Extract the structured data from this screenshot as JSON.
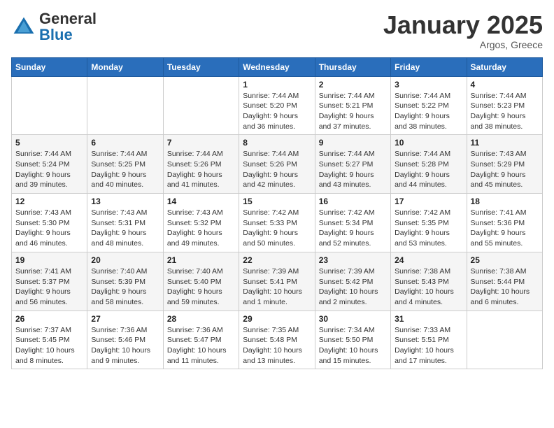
{
  "logo": {
    "general": "General",
    "blue": "Blue"
  },
  "title": "January 2025",
  "location": "Argos, Greece",
  "days_header": [
    "Sunday",
    "Monday",
    "Tuesday",
    "Wednesday",
    "Thursday",
    "Friday",
    "Saturday"
  ],
  "weeks": [
    [
      {
        "day": "",
        "info": ""
      },
      {
        "day": "",
        "info": ""
      },
      {
        "day": "",
        "info": ""
      },
      {
        "day": "1",
        "info": "Sunrise: 7:44 AM\nSunset: 5:20 PM\nDaylight: 9 hours and 36 minutes."
      },
      {
        "day": "2",
        "info": "Sunrise: 7:44 AM\nSunset: 5:21 PM\nDaylight: 9 hours and 37 minutes."
      },
      {
        "day": "3",
        "info": "Sunrise: 7:44 AM\nSunset: 5:22 PM\nDaylight: 9 hours and 38 minutes."
      },
      {
        "day": "4",
        "info": "Sunrise: 7:44 AM\nSunset: 5:23 PM\nDaylight: 9 hours and 38 minutes."
      }
    ],
    [
      {
        "day": "5",
        "info": "Sunrise: 7:44 AM\nSunset: 5:24 PM\nDaylight: 9 hours and 39 minutes."
      },
      {
        "day": "6",
        "info": "Sunrise: 7:44 AM\nSunset: 5:25 PM\nDaylight: 9 hours and 40 minutes."
      },
      {
        "day": "7",
        "info": "Sunrise: 7:44 AM\nSunset: 5:26 PM\nDaylight: 9 hours and 41 minutes."
      },
      {
        "day": "8",
        "info": "Sunrise: 7:44 AM\nSunset: 5:26 PM\nDaylight: 9 hours and 42 minutes."
      },
      {
        "day": "9",
        "info": "Sunrise: 7:44 AM\nSunset: 5:27 PM\nDaylight: 9 hours and 43 minutes."
      },
      {
        "day": "10",
        "info": "Sunrise: 7:44 AM\nSunset: 5:28 PM\nDaylight: 9 hours and 44 minutes."
      },
      {
        "day": "11",
        "info": "Sunrise: 7:43 AM\nSunset: 5:29 PM\nDaylight: 9 hours and 45 minutes."
      }
    ],
    [
      {
        "day": "12",
        "info": "Sunrise: 7:43 AM\nSunset: 5:30 PM\nDaylight: 9 hours and 46 minutes."
      },
      {
        "day": "13",
        "info": "Sunrise: 7:43 AM\nSunset: 5:31 PM\nDaylight: 9 hours and 48 minutes."
      },
      {
        "day": "14",
        "info": "Sunrise: 7:43 AM\nSunset: 5:32 PM\nDaylight: 9 hours and 49 minutes."
      },
      {
        "day": "15",
        "info": "Sunrise: 7:42 AM\nSunset: 5:33 PM\nDaylight: 9 hours and 50 minutes."
      },
      {
        "day": "16",
        "info": "Sunrise: 7:42 AM\nSunset: 5:34 PM\nDaylight: 9 hours and 52 minutes."
      },
      {
        "day": "17",
        "info": "Sunrise: 7:42 AM\nSunset: 5:35 PM\nDaylight: 9 hours and 53 minutes."
      },
      {
        "day": "18",
        "info": "Sunrise: 7:41 AM\nSunset: 5:36 PM\nDaylight: 9 hours and 55 minutes."
      }
    ],
    [
      {
        "day": "19",
        "info": "Sunrise: 7:41 AM\nSunset: 5:37 PM\nDaylight: 9 hours and 56 minutes."
      },
      {
        "day": "20",
        "info": "Sunrise: 7:40 AM\nSunset: 5:39 PM\nDaylight: 9 hours and 58 minutes."
      },
      {
        "day": "21",
        "info": "Sunrise: 7:40 AM\nSunset: 5:40 PM\nDaylight: 9 hours and 59 minutes."
      },
      {
        "day": "22",
        "info": "Sunrise: 7:39 AM\nSunset: 5:41 PM\nDaylight: 10 hours and 1 minute."
      },
      {
        "day": "23",
        "info": "Sunrise: 7:39 AM\nSunset: 5:42 PM\nDaylight: 10 hours and 2 minutes."
      },
      {
        "day": "24",
        "info": "Sunrise: 7:38 AM\nSunset: 5:43 PM\nDaylight: 10 hours and 4 minutes."
      },
      {
        "day": "25",
        "info": "Sunrise: 7:38 AM\nSunset: 5:44 PM\nDaylight: 10 hours and 6 minutes."
      }
    ],
    [
      {
        "day": "26",
        "info": "Sunrise: 7:37 AM\nSunset: 5:45 PM\nDaylight: 10 hours and 8 minutes."
      },
      {
        "day": "27",
        "info": "Sunrise: 7:36 AM\nSunset: 5:46 PM\nDaylight: 10 hours and 9 minutes."
      },
      {
        "day": "28",
        "info": "Sunrise: 7:36 AM\nSunset: 5:47 PM\nDaylight: 10 hours and 11 minutes."
      },
      {
        "day": "29",
        "info": "Sunrise: 7:35 AM\nSunset: 5:48 PM\nDaylight: 10 hours and 13 minutes."
      },
      {
        "day": "30",
        "info": "Sunrise: 7:34 AM\nSunset: 5:50 PM\nDaylight: 10 hours and 15 minutes."
      },
      {
        "day": "31",
        "info": "Sunrise: 7:33 AM\nSunset: 5:51 PM\nDaylight: 10 hours and 17 minutes."
      },
      {
        "day": "",
        "info": ""
      }
    ]
  ]
}
